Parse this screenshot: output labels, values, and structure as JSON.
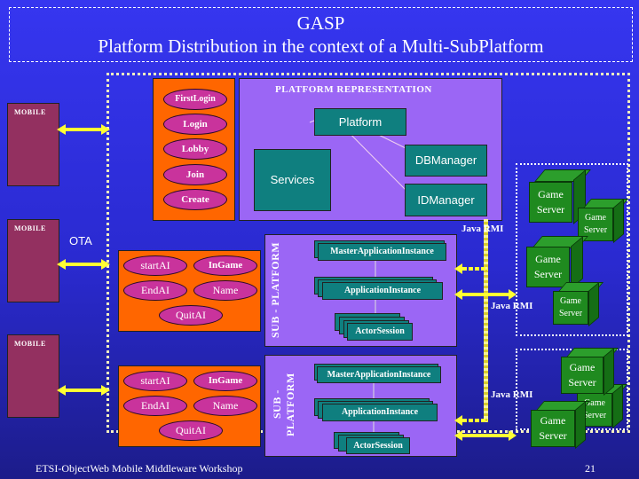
{
  "title": {
    "line1": "GASP",
    "line2": "Platform Distribution in the context of a Multi-SubPlatform"
  },
  "mobiles": [
    {
      "label": "MOBILE"
    },
    {
      "label": "MOBILE"
    },
    {
      "label": "MOBILE"
    }
  ],
  "ota_label": "OTA",
  "login_services": [
    "FirstLogin",
    "Login",
    "Lobby",
    "Join",
    "Create"
  ],
  "platform_representation": {
    "title": "PLATFORM REPRESENTATION",
    "platform": "Platform",
    "services": "Services",
    "db_manager": "DBManager",
    "id_manager": "IDManager"
  },
  "game_services": [
    {
      "startAI": "startAI",
      "inGame": "InGame",
      "endAI": "EndAI",
      "name": "Name",
      "quitAI": "QuitAI"
    },
    {
      "startAI": "startAI",
      "inGame": "InGame",
      "endAI": "EndAI",
      "name": "Name",
      "quitAI": "QuitAI"
    }
  ],
  "sub_platforms": [
    {
      "label": "SUB - PLATFORM",
      "master": "MasterApplicationInstance",
      "app": "ApplicationInstance",
      "actor": "ActorSession"
    },
    {
      "label": "SUB - PLATFORM",
      "master": "MasterApplicationInstance",
      "app": "ApplicationInstance",
      "actor": "ActorSession"
    }
  ],
  "java_rmi": "Java RMI",
  "game_server": "Game Server",
  "game_server_lines": [
    "Game",
    "Server"
  ],
  "footer": {
    "left": "ETSI-ObjectWeb Mobile Middleware Workshop",
    "page": "21"
  },
  "colors": {
    "background": "#3333ee",
    "orange": "#ff6600",
    "purple": "#9b66f5",
    "teal": "#0f7f7f",
    "magenta": "#c9339c",
    "green": "#1f8a1f",
    "arrow": "#ffff33"
  }
}
